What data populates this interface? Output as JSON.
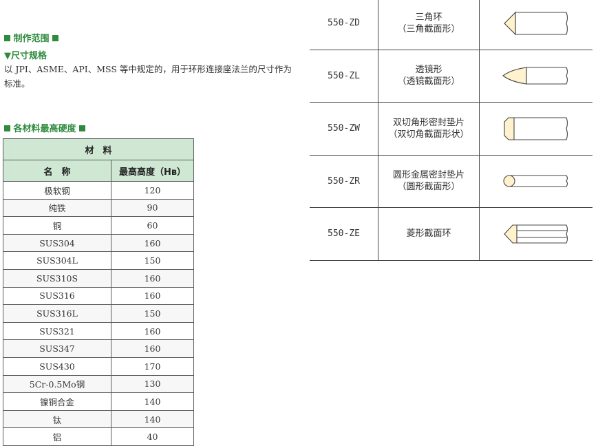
{
  "sections": {
    "scope_title": "制作范围",
    "size_subtitle": "▼尺寸规格",
    "size_text": "以 JPI、ASME、API、MSS 等中规定的，用于环形连接座法兰的尺寸作为标准。",
    "hardness_title": "各材料最高硬度"
  },
  "hardness_table": {
    "group_header": "材　料",
    "col_name": "名　称",
    "col_hardness": "最高高度（Hʙ）",
    "rows": [
      {
        "name": "极软钢",
        "value": "120"
      },
      {
        "name": "纯铁",
        "value": "90"
      },
      {
        "name": "铜",
        "value": "60"
      },
      {
        "name": "SUS304",
        "value": "160"
      },
      {
        "name": "SUS304L",
        "value": "150"
      },
      {
        "name": "SUS310S",
        "value": "160"
      },
      {
        "name": "SUS316",
        "value": "160"
      },
      {
        "name": "SUS316L",
        "value": "150"
      },
      {
        "name": "SUS321",
        "value": "160"
      },
      {
        "name": "SUS347",
        "value": "160"
      },
      {
        "name": "SUS430",
        "value": "170"
      },
      {
        "name": "5Cr-0.5Mo钢",
        "value": "130"
      },
      {
        "name": "镍铜合金",
        "value": "140"
      },
      {
        "name": "钛",
        "value": "140"
      },
      {
        "name": "铝",
        "value": "40"
      }
    ]
  },
  "ring_types": [
    {
      "code": "550-ZD",
      "line1": "三角环",
      "line2": "（三角截面形）",
      "icon": "triangle-section-icon"
    },
    {
      "code": "550-ZL",
      "line1": "透镜形",
      "line2": "（透镜截面形）",
      "icon": "lens-section-icon"
    },
    {
      "code": "550-ZW",
      "line1": "双切角形密封垫片",
      "line2": "（双切角截面形状）",
      "icon": "double-chamfer-section-icon"
    },
    {
      "code": "550-ZR",
      "line1": "圆形金属密封垫片",
      "line2": "（圆形截面形）",
      "icon": "round-section-icon"
    },
    {
      "code": "550-ZE",
      "line1": "菱形截面环",
      "line2": "",
      "icon": "diamond-section-icon"
    }
  ],
  "colors": {
    "accent_green": "#2e8b3e",
    "header_fill": "#cfe8d3",
    "shape_fill": "#fff2cc"
  }
}
